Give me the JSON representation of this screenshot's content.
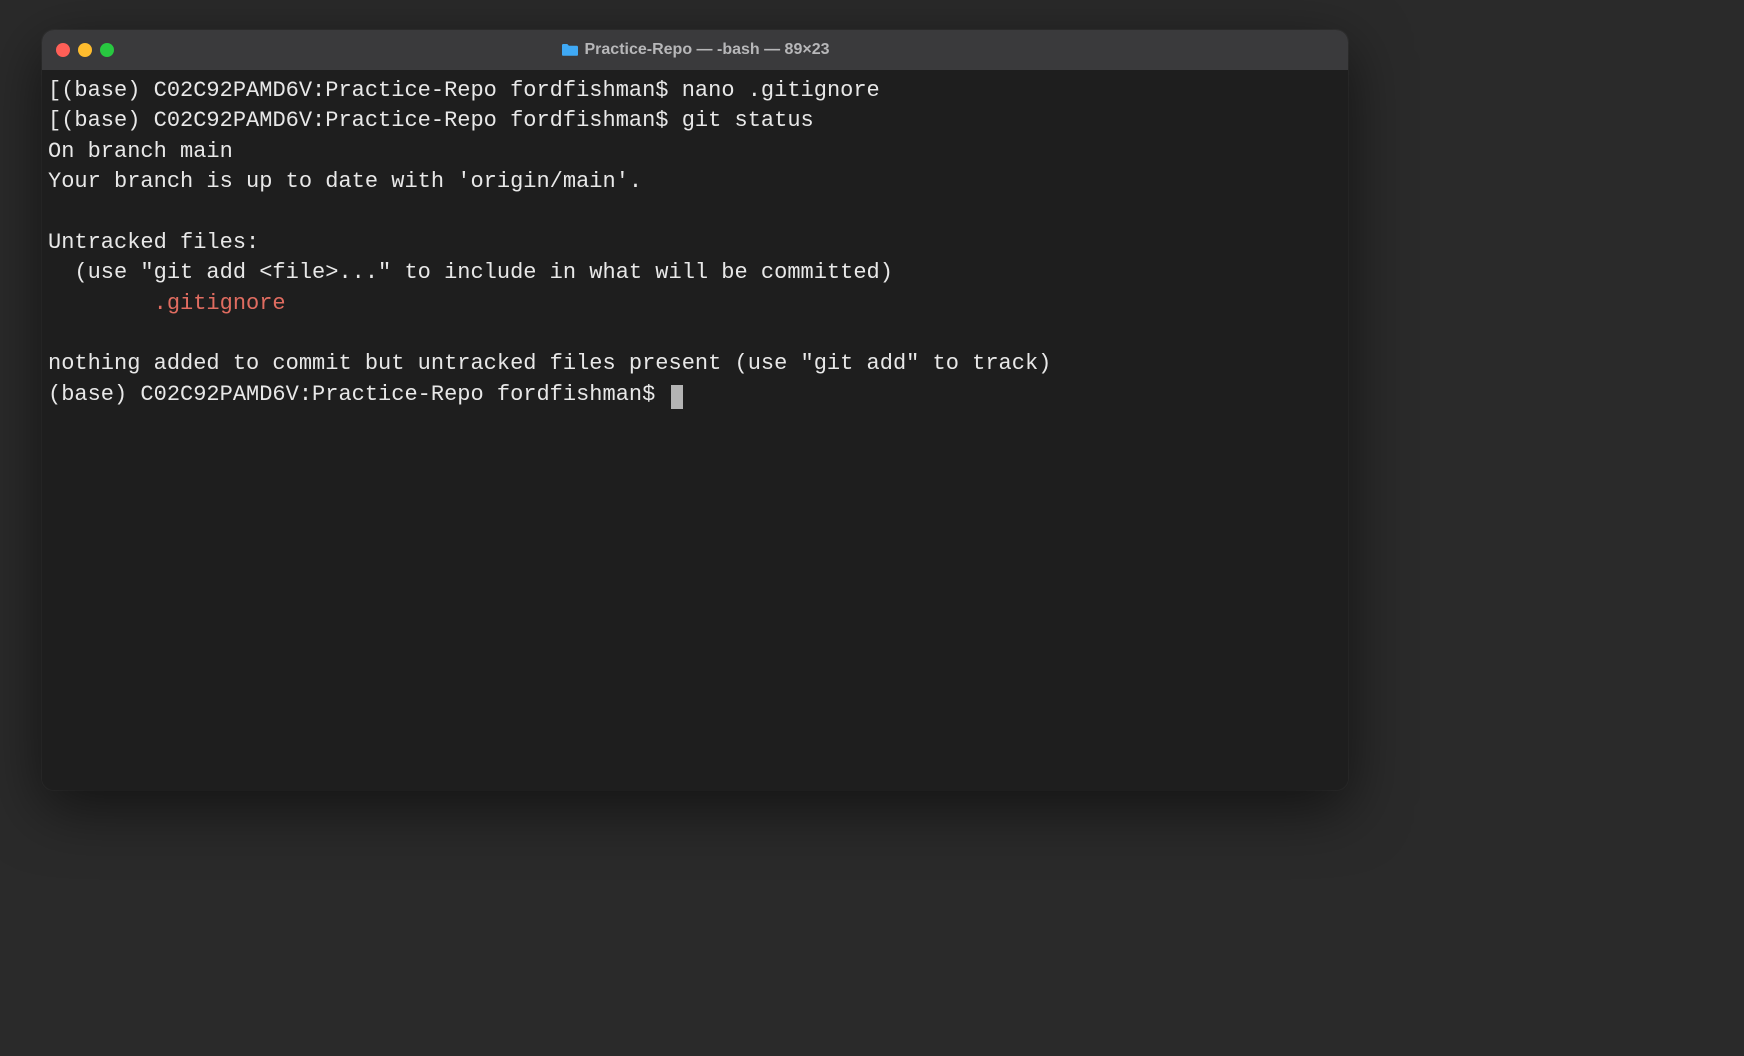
{
  "window": {
    "title": "Practice-Repo — -bash — 89×23"
  },
  "prompt": "(base) C02C92PAMD6V:Practice-Repo fordfishman$ ",
  "lines": {
    "cmd1": "nano .gitignore",
    "cmd2": "git status",
    "branch": "On branch main",
    "uptodate": "Your branch is up to date with 'origin/main'.",
    "untracked_header": "Untracked files:",
    "untracked_hint": "  (use \"git add <file>...\" to include in what will be committed)",
    "untracked_file": "        .gitignore",
    "nothing_added": "nothing added to commit but untracked files present (use \"git add\" to track)"
  },
  "brackets": {
    "open": "[",
    "close": "]"
  }
}
